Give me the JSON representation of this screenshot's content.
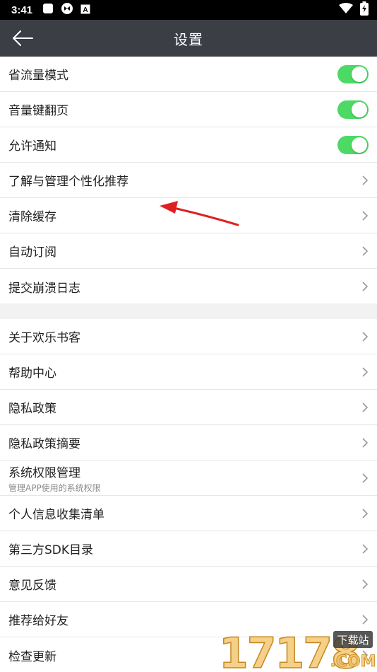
{
  "status_bar": {
    "time": "3:41",
    "left_icons": [
      "square-icon",
      "sync-icon",
      "a-badge-icon"
    ],
    "right_icons": [
      "wifi-icon",
      "battery-charging-icon"
    ]
  },
  "header": {
    "title": "设置",
    "back_icon": "arrow-left-icon"
  },
  "section1": {
    "toggles": [
      {
        "label": "省流量模式",
        "on": true
      },
      {
        "label": "音量键翻页",
        "on": true
      },
      {
        "label": "允许通知",
        "on": true
      }
    ],
    "items": [
      {
        "label": "了解与管理个性化推荐"
      },
      {
        "label": "清除缓存"
      },
      {
        "label": "自动订阅"
      },
      {
        "label": "提交崩溃日志"
      }
    ]
  },
  "section2": {
    "items": [
      {
        "label": "关于欢乐书客"
      },
      {
        "label": "帮助中心"
      },
      {
        "label": "隐私政策"
      },
      {
        "label": "隐私政策摘要"
      },
      {
        "label": "系统权限管理",
        "sub": "管理APP使用的系统权限"
      },
      {
        "label": "个人信息收集清单"
      },
      {
        "label": "第三方SDK目录"
      },
      {
        "label": "意见反馈"
      },
      {
        "label": "推荐给好友"
      },
      {
        "label": "检查更新"
      }
    ]
  },
  "watermark": {
    "digits": "17178",
    "site": "下载站",
    "domain": ".COM"
  },
  "colors": {
    "app_bar": "#3b3e45",
    "toggle_on": "#4cd964",
    "annotation_arrow": "#e02020",
    "background": "#f2f2f2"
  }
}
